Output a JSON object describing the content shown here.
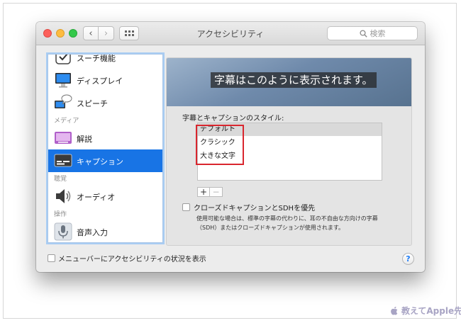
{
  "window": {
    "title": "アクセシビリティ",
    "search_placeholder": "検索"
  },
  "sidebar": {
    "items": [
      {
        "label": "スーチ機能",
        "icon": "switch-control-icon"
      },
      {
        "label": "ディスプレイ",
        "icon": "display-icon"
      },
      {
        "label": "スピーチ",
        "icon": "speech-icon"
      },
      {
        "label": "解説",
        "icon": "descriptions-icon"
      },
      {
        "label": "キャプション",
        "icon": "captions-icon",
        "selected": true
      },
      {
        "label": "オーディオ",
        "icon": "audio-speaker-icon"
      },
      {
        "label": "音声入力",
        "icon": "microphone-icon"
      }
    ],
    "groups": [
      "メディア",
      "聴覚",
      "操作"
    ]
  },
  "main": {
    "preview_text": "字幕はこのように表示されます。",
    "styles_label": "字幕とキャプションのスタイル:",
    "styles": [
      "デフォルト",
      "クラシック",
      "大きな文字"
    ],
    "add_label": "+",
    "remove_label": "−",
    "sdh_label": "クローズドキャプションとSDHを優先",
    "sdh_desc": "使用可能な場合は、標準の字幕の代わりに、耳の不自由な方向けの字幕（SDH）またはクローズドキャプションが使用されます。"
  },
  "footer": {
    "menu_bar_label": "メニューバーにアクセシビリティの状況を表示",
    "help_label": "?"
  },
  "watermark": "教えてApple先生",
  "colors": {
    "selection": "#1874e5",
    "highlight_box": "#d9262e"
  }
}
